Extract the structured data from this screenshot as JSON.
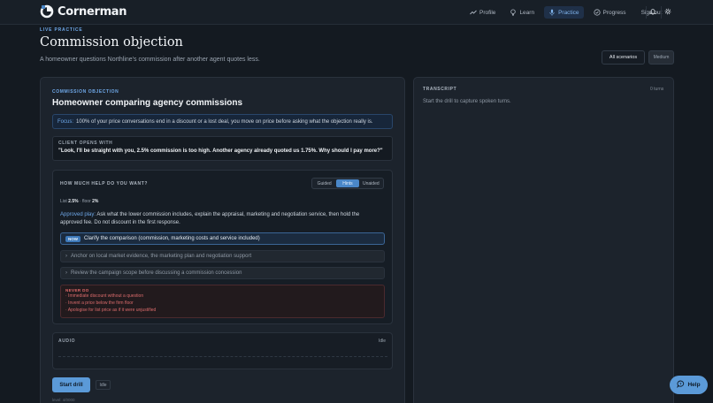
{
  "app": {
    "brand": "Cornerman"
  },
  "nav": {
    "items": [
      {
        "label": "Profile",
        "icon": "trend-icon"
      },
      {
        "label": "Learn",
        "icon": "bulb-icon"
      },
      {
        "label": "Practice",
        "icon": "mic-icon",
        "active": true
      },
      {
        "label": "Progress",
        "icon": "progress-icon"
      }
    ],
    "signout": "Sign out"
  },
  "header": {
    "eyebrow": "LIVE PRACTICE",
    "title": "Commission objection",
    "subtitle": "A homeowner questions Northline's commission after another agent quotes less.",
    "all_scenarios": "All scenarios",
    "difficulty": "Medium"
  },
  "scenario": {
    "eyebrow": "COMMISSION OBJECTION",
    "title": "Homeowner comparing agency commissions",
    "focus_label": "Focus:",
    "focus_text": "100% of your price conversations end in a discount or a lost deal, you move on price before asking what the objection really is.",
    "client_label": "CLIENT OPENS WITH",
    "client_quote": "\"Look, I'll be straight with you, 2.5% commission is too high. Another agency already quoted us 1.75%. Why should I pay more?\""
  },
  "help": {
    "label": "HOW MUCH HELP DO YOU WANT?",
    "options": [
      "Guided",
      "Hints",
      "Unaided"
    ],
    "selected": "Hints",
    "list_label": "List",
    "list_value": "2.5%",
    "sep": "· floor",
    "floor_value": "2%",
    "approved_label": "Approved play:",
    "approved_text": "Ask what the lower commission includes, explain the appraisal, marketing and negotiation service, then hold the approved fee. Do not discount in the first response.",
    "now_badge": "NOW",
    "steps": [
      "Clarify the comparison (commission, marketing costs and service included)",
      "Anchor on local market evidence, the marketing plan and negotiation support",
      "Review the campaign scope before discussing a commission concession"
    ],
    "never_title": "NEVER DO",
    "never_items": [
      "· Immediate discount without a question",
      "· Invent a price below the firm floor",
      "· Apologise for list price as if it were unjustified"
    ]
  },
  "audio": {
    "label": "AUDIO",
    "status": "Idle"
  },
  "controls": {
    "start": "Start drill",
    "state": "Idle",
    "footer": "level: 4/0000"
  },
  "transcript": {
    "label": "TRANSCRIPT",
    "count": "0 turns",
    "empty": "Start the drill to capture spoken turns."
  },
  "help_button": "Help",
  "colors": {
    "accent": "#5b9ad8",
    "background": "#141a21",
    "panel": "#1c232c",
    "danger": "#e46a6a"
  }
}
